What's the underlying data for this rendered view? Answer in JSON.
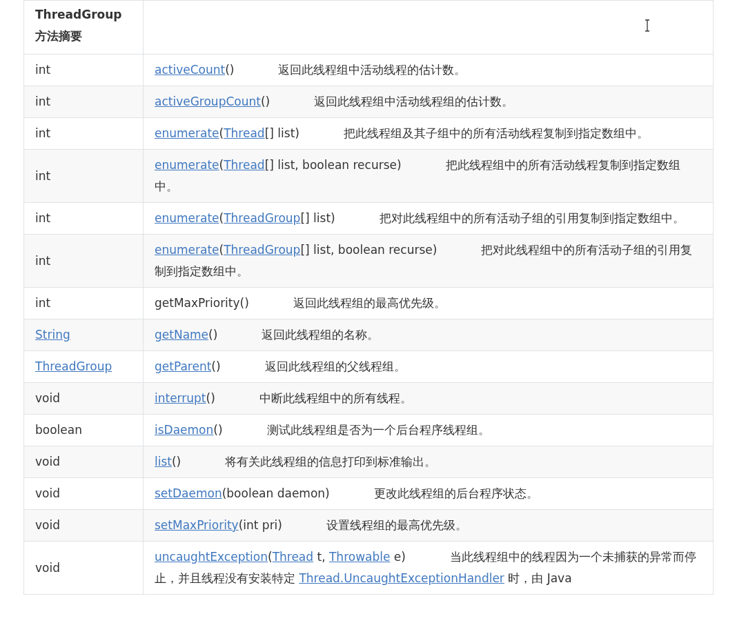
{
  "table": {
    "header": "ThreadGroup 方法摘要",
    "rows": [
      {
        "type": {
          "text": "int",
          "kind": "plain"
        },
        "method": [
          {
            "text": "activeCount",
            "kind": "link"
          },
          {
            "text": "()",
            "kind": "plain"
          }
        ],
        "description": "返回此线程组中活动线程的估计数。"
      },
      {
        "type": {
          "text": "int",
          "kind": "plain"
        },
        "method": [
          {
            "text": "activeGroupCount",
            "kind": "link"
          },
          {
            "text": "()",
            "kind": "plain"
          }
        ],
        "description": "返回此线程组中活动线程组的估计数。"
      },
      {
        "type": {
          "text": "int",
          "kind": "plain"
        },
        "method": [
          {
            "text": "enumerate",
            "kind": "link"
          },
          {
            "text": "(",
            "kind": "plain"
          },
          {
            "text": "Thread",
            "kind": "link"
          },
          {
            "text": "[] list)",
            "kind": "plain"
          }
        ],
        "description": "把此线程组及其子组中的所有活动线程复制到指定数组中。"
      },
      {
        "type": {
          "text": "int",
          "kind": "plain"
        },
        "method": [
          {
            "text": "enumerate",
            "kind": "link"
          },
          {
            "text": "(",
            "kind": "plain"
          },
          {
            "text": "Thread",
            "kind": "link"
          },
          {
            "text": "[] list,  boolean recurse)",
            "kind": "plain"
          }
        ],
        "description": "把此线程组中的所有活动线程复制到指定数组中。"
      },
      {
        "type": {
          "text": "int",
          "kind": "plain"
        },
        "method": [
          {
            "text": "enumerate",
            "kind": "link"
          },
          {
            "text": "(",
            "kind": "plain"
          },
          {
            "text": "ThreadGroup",
            "kind": "link"
          },
          {
            "text": "[] list)",
            "kind": "plain"
          }
        ],
        "description": "把对此线程组中的所有活动子组的引用复制到指定数组中。"
      },
      {
        "type": {
          "text": "int",
          "kind": "plain"
        },
        "method": [
          {
            "text": "enumerate",
            "kind": "link"
          },
          {
            "text": "(",
            "kind": "plain"
          },
          {
            "text": "ThreadGroup",
            "kind": "link"
          },
          {
            "text": "[] list,  boolean recurse)",
            "kind": "plain"
          }
        ],
        "description": "把对此线程组中的所有活动子组的引用复制到指定数组中。"
      },
      {
        "type": {
          "text": "int",
          "kind": "plain"
        },
        "method": [
          {
            "text": "getMaxPriority()",
            "kind": "plain"
          }
        ],
        "description": "返回此线程组的最高优先级。"
      },
      {
        "type": {
          "text": "String",
          "kind": "link"
        },
        "method": [
          {
            "text": "getName",
            "kind": "link"
          },
          {
            "text": "()",
            "kind": "plain"
          }
        ],
        "description": "返回此线程组的名称。"
      },
      {
        "type": {
          "text": "ThreadGroup",
          "kind": "link"
        },
        "method": [
          {
            "text": "getParent",
            "kind": "link"
          },
          {
            "text": "()",
            "kind": "plain"
          }
        ],
        "description": "返回此线程组的父线程组。"
      },
      {
        "type": {
          "text": "void",
          "kind": "plain"
        },
        "method": [
          {
            "text": "interrupt",
            "kind": "link"
          },
          {
            "text": "()",
            "kind": "plain"
          }
        ],
        "description": "中断此线程组中的所有线程。"
      },
      {
        "type": {
          "text": "boolean",
          "kind": "plain"
        },
        "method": [
          {
            "text": "isDaemon",
            "kind": "link"
          },
          {
            "text": "()",
            "kind": "plain"
          }
        ],
        "description": "测试此线程组是否为一个后台程序线程组。"
      },
      {
        "type": {
          "text": "void",
          "kind": "plain"
        },
        "method": [
          {
            "text": "list",
            "kind": "link"
          },
          {
            "text": "()",
            "kind": "plain"
          }
        ],
        "description": "将有关此线程组的信息打印到标准输出。"
      },
      {
        "type": {
          "text": "void",
          "kind": "plain"
        },
        "method": [
          {
            "text": "setDaemon",
            "kind": "link"
          },
          {
            "text": "(boolean daemon)",
            "kind": "plain"
          }
        ],
        "description": "更改此线程组的后台程序状态。"
      },
      {
        "type": {
          "text": "void",
          "kind": "plain"
        },
        "method": [
          {
            "text": "setMaxPriority",
            "kind": "link"
          },
          {
            "text": "(int pri)",
            "kind": "plain"
          }
        ],
        "description": "设置线程组的最高优先级。"
      },
      {
        "type": {
          "text": "void",
          "kind": "plain"
        },
        "method": [
          {
            "text": "uncaughtException",
            "kind": "link"
          },
          {
            "text": "(",
            "kind": "plain"
          },
          {
            "text": "Thread",
            "kind": "link"
          },
          {
            "text": " t,  ",
            "kind": "plain"
          },
          {
            "text": "Throwable",
            "kind": "link"
          },
          {
            "text": " e)",
            "kind": "plain"
          },
          {
            "text": "当此线程组中的线程因为一个未捕获的异常而停止，并且线程没有安装特定 ",
            "kind": "description"
          },
          {
            "text": "Thread.UncaughtExceptionHandler",
            "kind": "link"
          },
          {
            "text": " 时，由 Java",
            "kind": "plain"
          }
        ]
      }
    ]
  }
}
